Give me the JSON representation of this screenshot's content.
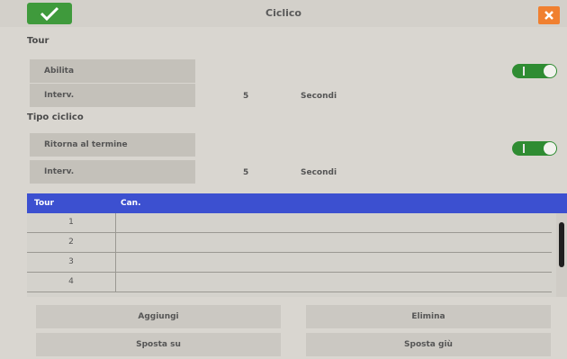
{
  "window": {
    "title": "Ciclico"
  },
  "tour_section": {
    "title": "Tour",
    "enable_label": "Abilita",
    "interval_label": "Interv.",
    "interval_value": "5",
    "interval_unit": "Secondi"
  },
  "cycle_section": {
    "title": "Tipo ciclico",
    "return_label": "Ritorna al termine",
    "interval_label": "Interv.",
    "interval_value": "5",
    "interval_unit": "Secondi"
  },
  "table": {
    "headers": [
      "Tour",
      "Can."
    ],
    "rows": [
      {
        "tour": "1",
        "channel": ""
      },
      {
        "tour": "2",
        "channel": ""
      },
      {
        "tour": "3",
        "channel": ""
      },
      {
        "tour": "4",
        "channel": ""
      }
    ]
  },
  "buttons": {
    "add": "Aggiungi",
    "delete": "Elimina",
    "move_up": "Sposta su",
    "move_down": "Sposta giù"
  },
  "icons": {
    "ok": "check-icon",
    "close": "close-icon"
  },
  "colors": {
    "accent": "#3c50d0",
    "ok": "#3f9a3c",
    "close": "#f08030",
    "toggle_on": "#2f8c32"
  }
}
